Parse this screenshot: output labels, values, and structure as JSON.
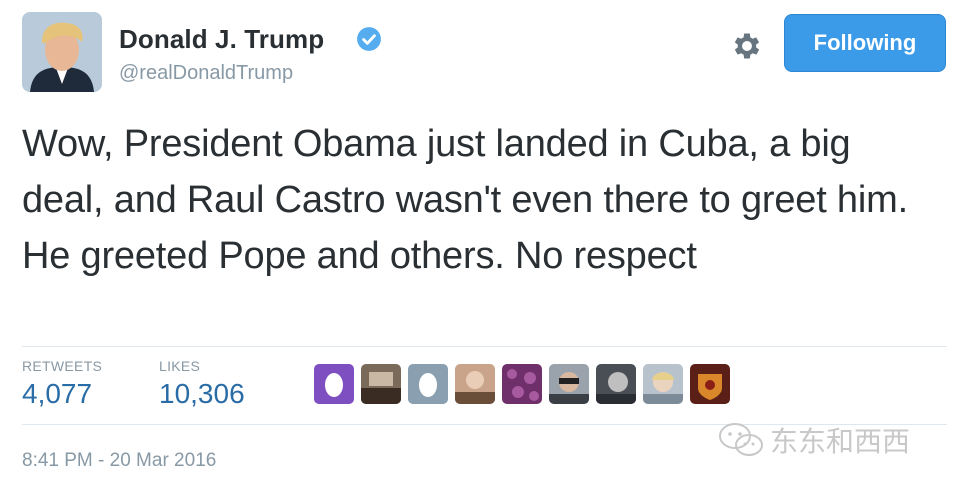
{
  "author": {
    "display_name": "Donald J. Trump",
    "handle": "@realDonaldTrump",
    "verified": true
  },
  "actions": {
    "settings_icon": "gear-icon",
    "follow_label": "Following"
  },
  "tweet": {
    "text": "Wow, President Obama just landed in Cuba, a big deal, and Raul Castro wasn't even there to greet him. He greeted Pope and others. No respect"
  },
  "stats": {
    "retweets_label": "RETWEETS",
    "retweets_count": "4,077",
    "likes_label": "LIKES",
    "likes_count": "10,306"
  },
  "likers": [
    {
      "icon": "avatar-purple-egg"
    },
    {
      "icon": "avatar-photo"
    },
    {
      "icon": "avatar-egg-gray"
    },
    {
      "icon": "avatar-photo"
    },
    {
      "icon": "avatar-pattern"
    },
    {
      "icon": "avatar-photo"
    },
    {
      "icon": "avatar-photo"
    },
    {
      "icon": "avatar-photo"
    },
    {
      "icon": "avatar-crest"
    }
  ],
  "timestamp": "8:41 PM - 20 Mar 2016",
  "watermark": "东东和西西",
  "colors": {
    "accent": "#3b9be8",
    "stat_value": "#2a6ca5",
    "muted": "#8899a6",
    "text": "#292f33"
  }
}
